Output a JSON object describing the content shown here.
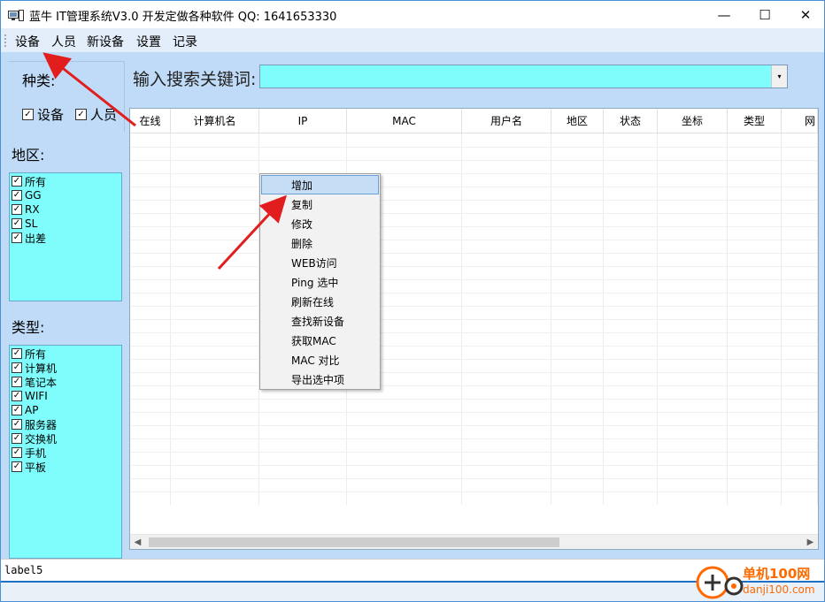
{
  "window": {
    "title": "蓝牛 IT管理系统V3.0  开发定做各种软件 QQ: 1641653330",
    "minimize_glyph": "—",
    "maximize_glyph": "☐",
    "close_glyph": "✕"
  },
  "menubar": {
    "items": [
      "设备",
      "人员",
      "新设备",
      "设置",
      "记录"
    ]
  },
  "left_panel": {
    "kind_label": "种类:",
    "kind_options": [
      {
        "label": "设备",
        "checked": true
      },
      {
        "label": "人员",
        "checked": true
      }
    ],
    "region_label": "地区:",
    "region_items": [
      "所有",
      "GG",
      "RX",
      "SL",
      "出差"
    ],
    "type_label": "类型:",
    "type_items": [
      "所有",
      "计算机",
      "笔记本",
      "WIFI",
      "AP",
      "服务器",
      "交换机",
      "手机",
      "平板"
    ]
  },
  "search": {
    "label": "输入搜索关键词:",
    "value": "",
    "dropdown_glyph": "▾"
  },
  "grid": {
    "columns": [
      "在线",
      "计算机名",
      "IP",
      "MAC",
      "用户名",
      "地区",
      "状态",
      "坐标",
      "类型",
      "网"
    ],
    "rows": []
  },
  "context_menu": {
    "items": [
      "增加",
      "复制",
      "修改",
      "删除",
      "WEB访问",
      "Ping 选中",
      "刷新在线",
      "查找新设备",
      "获取MAC",
      "MAC 对比",
      "导出选中项"
    ],
    "highlighted": "增加"
  },
  "statusbar": {
    "text": "label5"
  },
  "watermark": {
    "line1": "单机100网",
    "line2": "danji100.com"
  },
  "colors": {
    "accent_cyan": "#7ffdfd",
    "panel_bg": "#bfdbf7",
    "menubar_bg": "#e3eefa",
    "arrow_red": "#e21d1d",
    "highlight": "#c5def5"
  },
  "icons": {
    "app": "app-window-icon",
    "checkbox": "checkmark-icon",
    "dropdown": "chevron-down-icon",
    "scroll_left": "scroll-left-arrow-icon",
    "scroll_right": "scroll-right-arrow-icon"
  }
}
